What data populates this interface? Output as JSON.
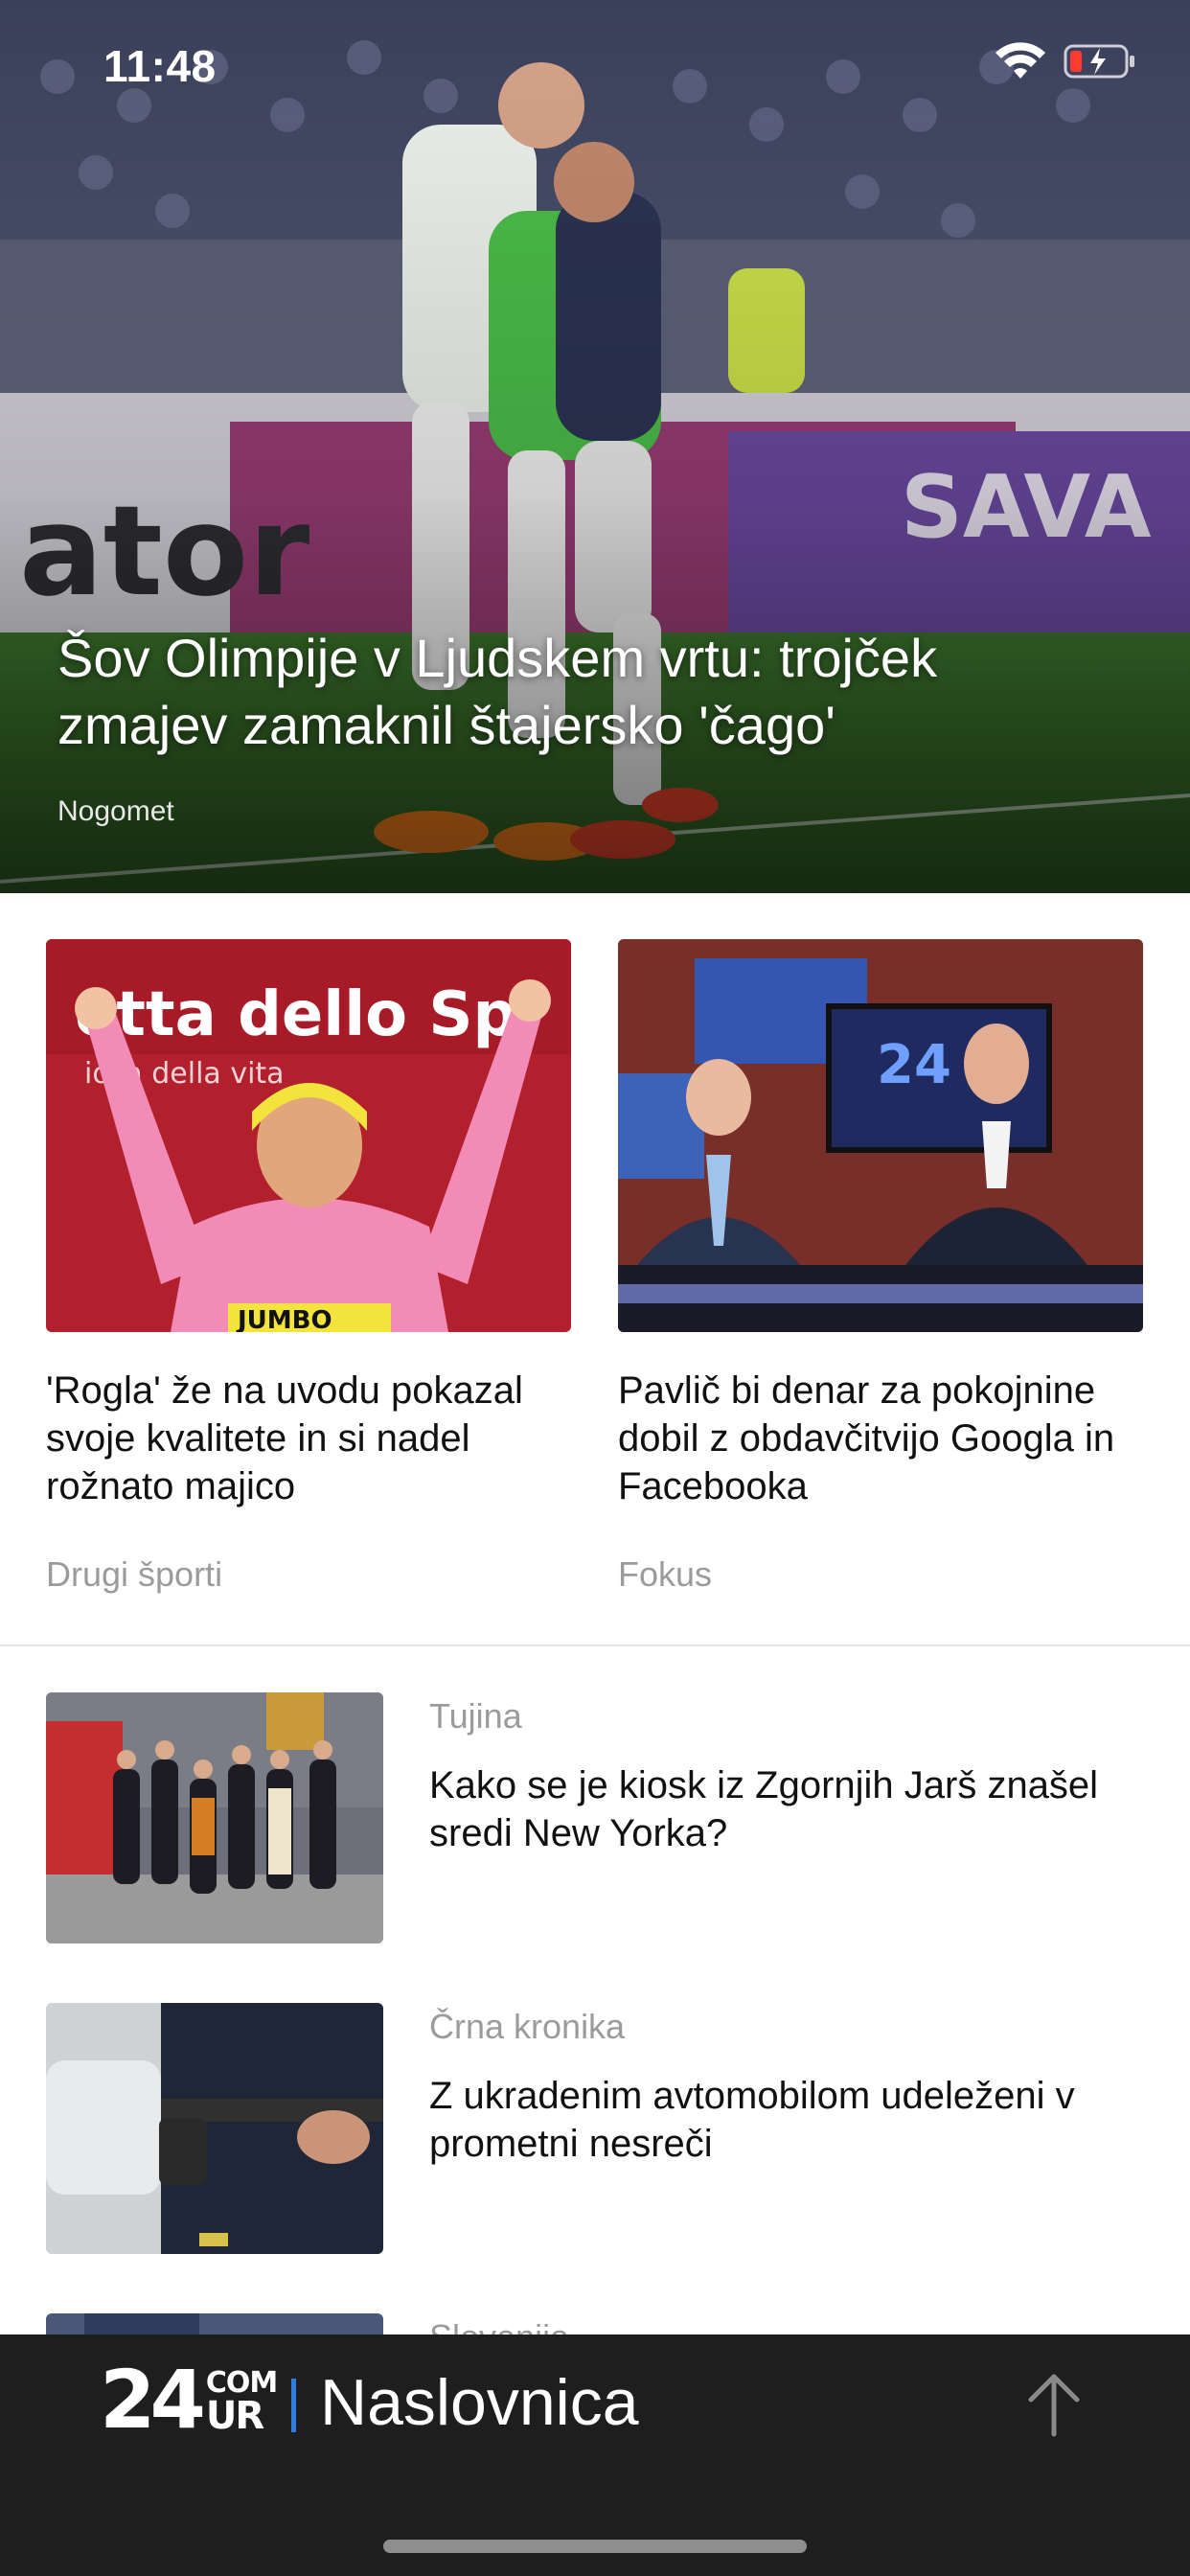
{
  "status_bar": {
    "time": "11:48"
  },
  "hero": {
    "title": "Šov Olimpije v Ljudskem vrtu: trojček zmajev zamaknil štajersko 'čago'",
    "category": "Nogomet"
  },
  "cards": [
    {
      "title": "'Rogla' že na uvodu pokazal svoje kvalitete in si nadel rožnato majico",
      "category": "Drugi športi"
    },
    {
      "title": "Pavlič bi denar za pokojnine dobil z obdavčitvijo Googla in Facebooka",
      "category": "Fokus"
    }
  ],
  "list": [
    {
      "category": "Tujina",
      "title": "Kako se je kiosk iz Zgornjih Jarš znašel sredi New Yorka?"
    },
    {
      "category": "Črna kronika",
      "title": "Z ukradenim avtomobilom udeleženi v prometni nesreči"
    },
    {
      "category": "Slovenija"
    }
  ],
  "bottom_bar": {
    "logo_24": "24",
    "logo_com": "COM",
    "logo_ur": "UR",
    "section": "Naslovnica",
    "accent": "#2f7de1",
    "background": "#1e1e1e",
    "icons": [
      "wifi-icon",
      "battery-charging-icon",
      "arrow-up-icon"
    ]
  }
}
